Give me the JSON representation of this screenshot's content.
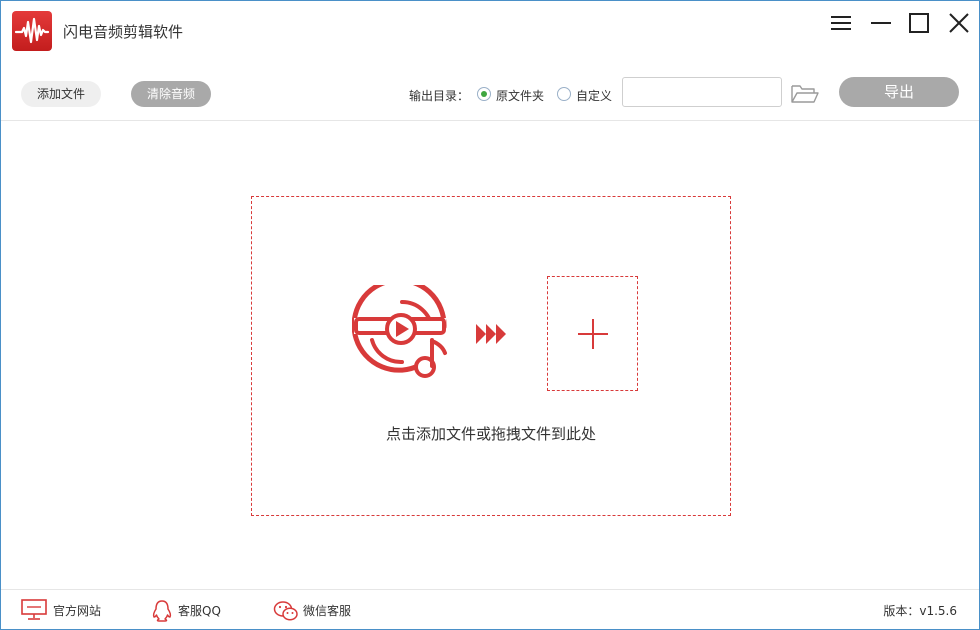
{
  "app": {
    "title": "闪电音频剪辑软件",
    "accent_color": "#d83a3a",
    "logo_icon": "waveform-logo-icon"
  },
  "window_controls": {
    "menu_icon": "hamburger-menu-icon",
    "minimize_icon": "minimize-icon",
    "maximize_icon": "maximize-icon",
    "close_icon": "close-icon"
  },
  "toolbar": {
    "add_file_label": "添加文件",
    "clear_audio_label": "清除音频",
    "output_dir_label": "输出目录：",
    "output_options": [
      {
        "label": "原文件夹",
        "checked": true
      },
      {
        "label": "自定义",
        "checked": false
      }
    ],
    "path_value": "",
    "folder_icon": "folder-open-icon",
    "export_label": "导出"
  },
  "drop_zone": {
    "media_icon": "video-music-disc-icon",
    "arrows_icon": "fast-forward-arrows-icon",
    "plus_icon": "plus-icon",
    "hint": "点击添加文件或拖拽文件到此处"
  },
  "footer": {
    "links": [
      {
        "label": "官方网站",
        "icon": "monitor-icon"
      },
      {
        "label": "客服QQ",
        "icon": "qq-penguin-icon"
      },
      {
        "label": "微信客服",
        "icon": "wechat-icon"
      }
    ],
    "version": "版本：v1.5.6"
  }
}
